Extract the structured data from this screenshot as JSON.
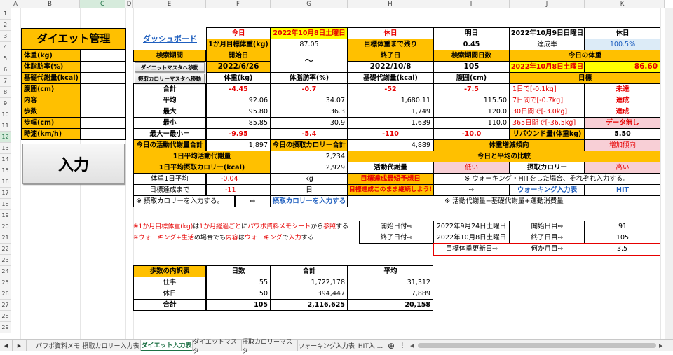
{
  "columns": [
    "A",
    "B",
    "C",
    "D",
    "E",
    "F",
    "G",
    "H",
    "I",
    "J",
    "K"
  ],
  "rows": [
    "1",
    "2",
    "3",
    "4",
    "5",
    "6",
    "7",
    "8",
    "9",
    "10",
    "11",
    "12",
    "13",
    "14",
    "15",
    "16",
    "17",
    "18",
    "19",
    "20",
    "21",
    "22",
    "23",
    "24",
    "25",
    "26",
    "27",
    "28",
    "29"
  ],
  "left_panel": {
    "title": "ダイエット管理",
    "labels": [
      "体重(kg)",
      "体脂肪率(%)",
      "基礎代謝量(kcal)",
      "腹囲(cm)",
      "内容",
      "歩数",
      "歩幅(cm)",
      "時速(km/h)"
    ],
    "input_button": "入力"
  },
  "dashboard": {
    "link": "ダッシュボード",
    "today_label": "今日",
    "today_date": "2022年10月8日土曜日",
    "holiday": "休日",
    "tomorrow_label": "明日",
    "tomorrow_date": "2022年10月9日日曜日",
    "holiday2": "休日",
    "target_label": "1か月目標体重(kg)",
    "target_value": "87.05",
    "remaining_label": "目標体重まで残り",
    "remaining_value": "0.45",
    "achievement_label": "達成率",
    "achievement_value": "100.5%",
    "period_label": "検索期間",
    "start_label": "開始日",
    "tilde": "～",
    "end_label": "終了日",
    "days_label": "検索期間日数",
    "today_weight_label": "今日の体重",
    "diet_master_button": "ダイエットマスタへ移動",
    "start_value": "2022/6/26",
    "end_value": "2022/10/8",
    "days_value": "105",
    "today_weight_date": "2022年10月8日土曜日",
    "today_weight_value": "86.60",
    "calorie_master_button": "摂取カロリーマスタへ移動",
    "col_weight": "体重(kg)",
    "col_fat": "体脂肪率(%)",
    "col_bmr": "基礎代謝量(kcal)",
    "col_waist": "腹囲(cm)",
    "col_goal": "目標"
  },
  "stats": [
    {
      "label": "合計",
      "weight": "-4.45",
      "fat": "-0.7",
      "bmr": "-52",
      "waist": "-7.5",
      "goal": "1日で[-0.1kg]",
      "result": "未達"
    },
    {
      "label": "平均",
      "weight": "92.06",
      "fat": "34.07",
      "bmr": "1,680.11",
      "waist": "115.50",
      "goal": "7日間で[-0.7kg]",
      "result": "達成"
    },
    {
      "label": "最大",
      "weight": "95.80",
      "fat": "36.3",
      "bmr": "1,749",
      "waist": "120.0",
      "goal": "30日間で[-3.0kg]",
      "result": "達成"
    },
    {
      "label": "最小",
      "weight": "85.85",
      "fat": "30.9",
      "bmr": "1,639",
      "waist": "110.0",
      "goal": "365日間で[-36.5kg]",
      "result": "データ無し"
    }
  ],
  "maxmin": {
    "label": "最大ー最小＝",
    "weight": "-9.95",
    "fat": "-5.4",
    "bmr": "-110",
    "waist": "-10.0",
    "rebound_label": "リバウンド量(体重kg)",
    "rebound_value": "5.50"
  },
  "activity": {
    "today_active_label": "今日の活動代謝量合計",
    "today_active_value": "1,897",
    "today_intake_label": "今日の摂取カロリー合計",
    "today_intake_value": "4,889",
    "trend_label": "体重増減傾向",
    "trend_value": "増加傾向",
    "avg_active_label": "1日平均活動代謝量",
    "avg_active_value": "2,234",
    "compare_label": "今日と平均の比較",
    "avg_intake_label": "1日平均摂取カロリー(kcal)",
    "avg_intake_value": "2,929",
    "active_cmp_label": "活動代謝量",
    "active_cmp_value": "低い",
    "intake_cmp_label": "摂取カロリー",
    "intake_cmp_value": "高い",
    "weight_avg_label": "体重1日平均",
    "weight_avg_value": "-0.04",
    "weight_avg_unit": "kg",
    "predict_label": "目標達成最短予想日",
    "predict_note": "※ ウォーキング・HITをした場合、それぞれ入力する。",
    "until_label": "目標達成まで",
    "until_value": "-11",
    "until_unit": "日",
    "keep_label": "目標達成このまま継続しよう!",
    "arrow": "⇨",
    "walking_link": "ウォーキング入力表",
    "hit_link": "HIT",
    "intake_note": "※ 摂取カロリーを入力する。",
    "intake_arrow": "⇨",
    "intake_link": "摂取カロリーを入力する",
    "formula_note": "※ 活動代謝量=基礎代謝量+運動消費量"
  },
  "notes": {
    "note1": {
      "p1": "※1か月目標体重(kg)",
      "p2": "は",
      "p3": "1か月経過ごと",
      "p4": "に",
      "p5": "パワポ資料メモシート",
      "p6": "から",
      "p7": "参照",
      "p8": "する"
    },
    "note2": {
      "p1": "※ウォーキング+生活",
      "p2": "の場合でも",
      "p3": "内容",
      "p4": "は",
      "p5": "ウォーキング",
      "p6": "で",
      "p7": "入力",
      "p8": "する"
    }
  },
  "dates": {
    "start_label": "開始日付⇨",
    "start_value": "2022年9月24日土曜日",
    "start_day_label": "開始日目⇨",
    "start_day_value": "91",
    "end_label": "終了日付⇨",
    "end_value": "2022年10月8日土曜日",
    "end_day_label": "終了日目⇨",
    "end_day_value": "105",
    "update_label": "目標体重更新日⇨",
    "which_month_label": "何か月目⇨",
    "which_month_value": "3.5"
  },
  "steps": {
    "headers": [
      "歩数の内訳表",
      "日数",
      "合計",
      "平均"
    ],
    "rows": [
      [
        "仕事",
        "55",
        "1,722,178",
        "31,312"
      ],
      [
        "休日",
        "50",
        "394,447",
        "7,889"
      ],
      [
        "合計",
        "105",
        "2,116,625",
        "20,158"
      ]
    ]
  },
  "tabs": [
    "パワポ資料メモ",
    "摂取カロリー入力表",
    "ダイエット入力表",
    "ダイエットマスタ",
    "摂取カロリーマスタ",
    "ウォーキング入力表",
    "HIT入 ..."
  ],
  "tab_controls": {
    "more": "…",
    "add": "⊕",
    "menu": "⋮",
    "prev": "◀",
    "next": "▶"
  },
  "colors": {
    "accent_yellow": "#ffc000",
    "bright_yellow": "#ffff00",
    "red": "#e60000",
    "link_blue": "#1f5fbf",
    "pink": "#f8cfd6",
    "excel_green": "#1e7145"
  }
}
